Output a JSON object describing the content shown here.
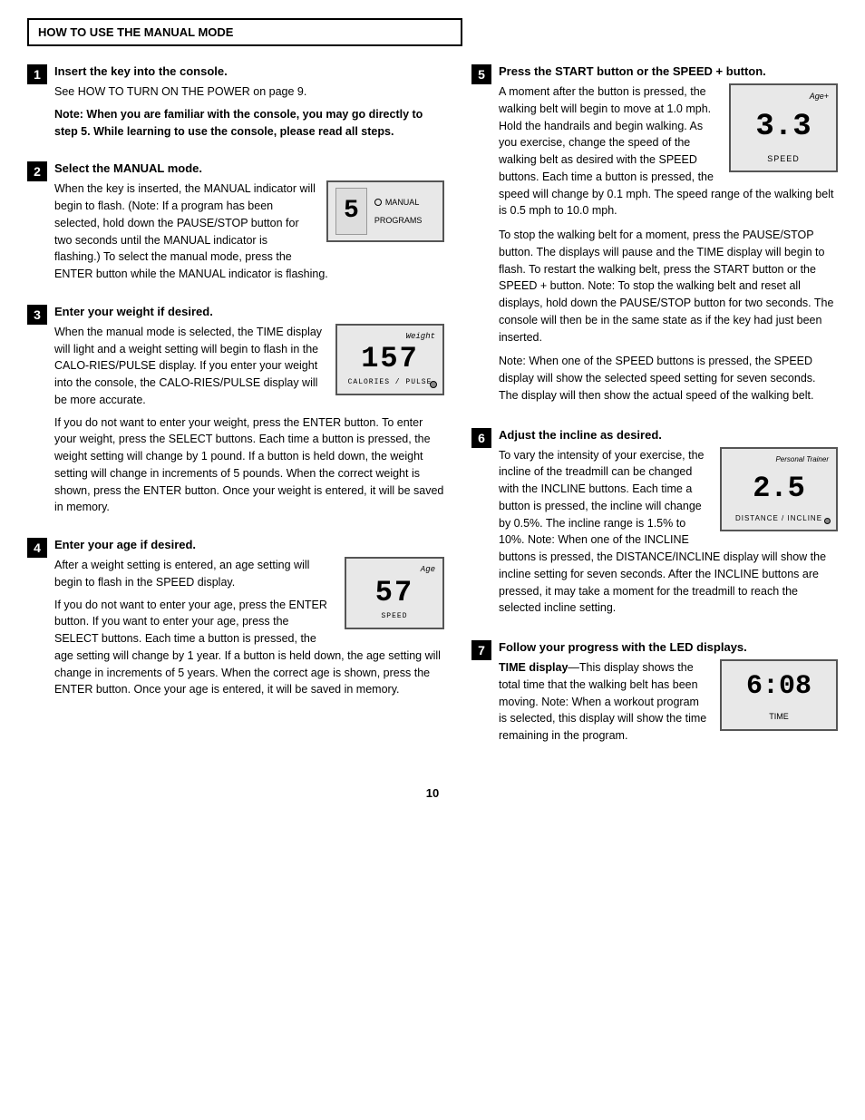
{
  "header": {
    "title": "HOW TO USE THE MANUAL MODE"
  },
  "page_number": "10",
  "left_steps": [
    {
      "number": "1",
      "title": "Insert the key into the console.",
      "body": [
        "See HOW TO TURN ON THE POWER on page 9.",
        "Note: When you are familiar with the console, you may go directly to step 5. While learning to use the console, please read all steps."
      ]
    },
    {
      "number": "2",
      "title": "Select the MANUAL mode.",
      "body": [
        "When the key is inserted, the MANUAL indicator will begin to flash. (Note: If a program has been selected, hold down the PAUSE/STOP button for two seconds until the MANUAL indicator is flashing.) To select the manual mode, press the ENTER button while the MANUAL indicator is flashing."
      ],
      "display": {
        "left_number": "5",
        "right_top": "● MANUAL",
        "right_bottom": "PROGRAMS"
      }
    },
    {
      "number": "3",
      "title": "Enter your weight if desired.",
      "body_before": "When the manual mode is selected, the TIME display will light and a weight setting will begin to flash in the CALO-RIES/PULSE display. If you enter your weight into the console, the CALO-RIES/PULSE display will be more accurate.",
      "body_after": [
        "If you do not want to enter your weight, press the ENTER button. To enter your weight, press the SELECT buttons. Each time a button is pressed, the weight setting will change by 1 pound. If a button is held down, the weight setting will change in increments of 5 pounds. When the correct weight is shown, press the ENTER button. Once your weight is entered, it will be saved in memory."
      ],
      "display": {
        "label_top": "Weight",
        "number": "157",
        "label_bottom": "CALORIES / PULSE",
        "has_dot": true
      }
    },
    {
      "number": "4",
      "title": "Enter your age if desired.",
      "body_before": "After a weight setting is entered, an age setting will begin to flash in the SPEED display.",
      "body_after": [
        "If you do not want to enter your age, press the ENTER button. If you want to enter your age, press the SELECT buttons. Each time a button is pressed, the age setting will change by 1 year. If a button is held down, the age setting will change in increments of 5 years. When the correct age is shown, press the ENTER button. Once your age is entered, it will be saved in memory."
      ],
      "display": {
        "label_top": "Age",
        "number": "57",
        "label_bottom": "SPEED"
      }
    }
  ],
  "right_steps": [
    {
      "number": "5",
      "title": "Press the START button or the SPEED + button.",
      "body": [
        "A moment after the button is pressed, the walking belt will begin to move at 1.0 mph. Hold the handrails and begin walking. As you exercise, change the speed of the walking belt as desired with the SPEED buttons. Each time a button is pressed, the speed will change by 0.1 mph. The speed range of the walking belt is 0.5 mph to 10.0 mph.",
        "To stop the walking belt for a moment, press the PAUSE/STOP button. The displays will pause and the TIME display will begin to flash. To restart the walking belt, press the START button or the SPEED + button. Note: To stop the walking belt and reset all displays, hold down the PAUSE/STOP button for two seconds. The console will then be in the same state as if the key had just been inserted.",
        "Note: When one of the SPEED buttons is pressed, the SPEED display will show the selected speed setting for seven seconds. The display will then show the actual speed of the walking belt."
      ],
      "display": {
        "label_top": "Age+",
        "number": "3.3",
        "label_bottom": "SPEED"
      }
    },
    {
      "number": "6",
      "title": "Adjust the incline as desired.",
      "body_before": "To vary the intensity of your exercise, the incline of the treadmill can be changed with the INCLINE buttons. Each time a button is pressed,",
      "body_after": [
        "the incline will change by 0.5%. The incline range is 1.5% to 10%. Note: When one of the INCLINE buttons is pressed, the DISTANCE/INCLINE display will show the incline setting for seven seconds. After the INCLINE buttons are pressed, it may take a moment for the treadmill to reach the selected incline setting."
      ],
      "display": {
        "label_top": "Personal Trainer",
        "number": "2.5",
        "label_bottom": "DISTANCE / INCLINE",
        "has_dot": true
      }
    },
    {
      "number": "7",
      "title": "Follow your progress with the LED displays.",
      "body": [
        "TIME display—This display shows the total time that the walking belt has been moving. Note: When a workout program is selected, this display will show the time remaining in the program."
      ],
      "display": {
        "number": "6:08",
        "label_bottom": "TIME"
      }
    }
  ]
}
